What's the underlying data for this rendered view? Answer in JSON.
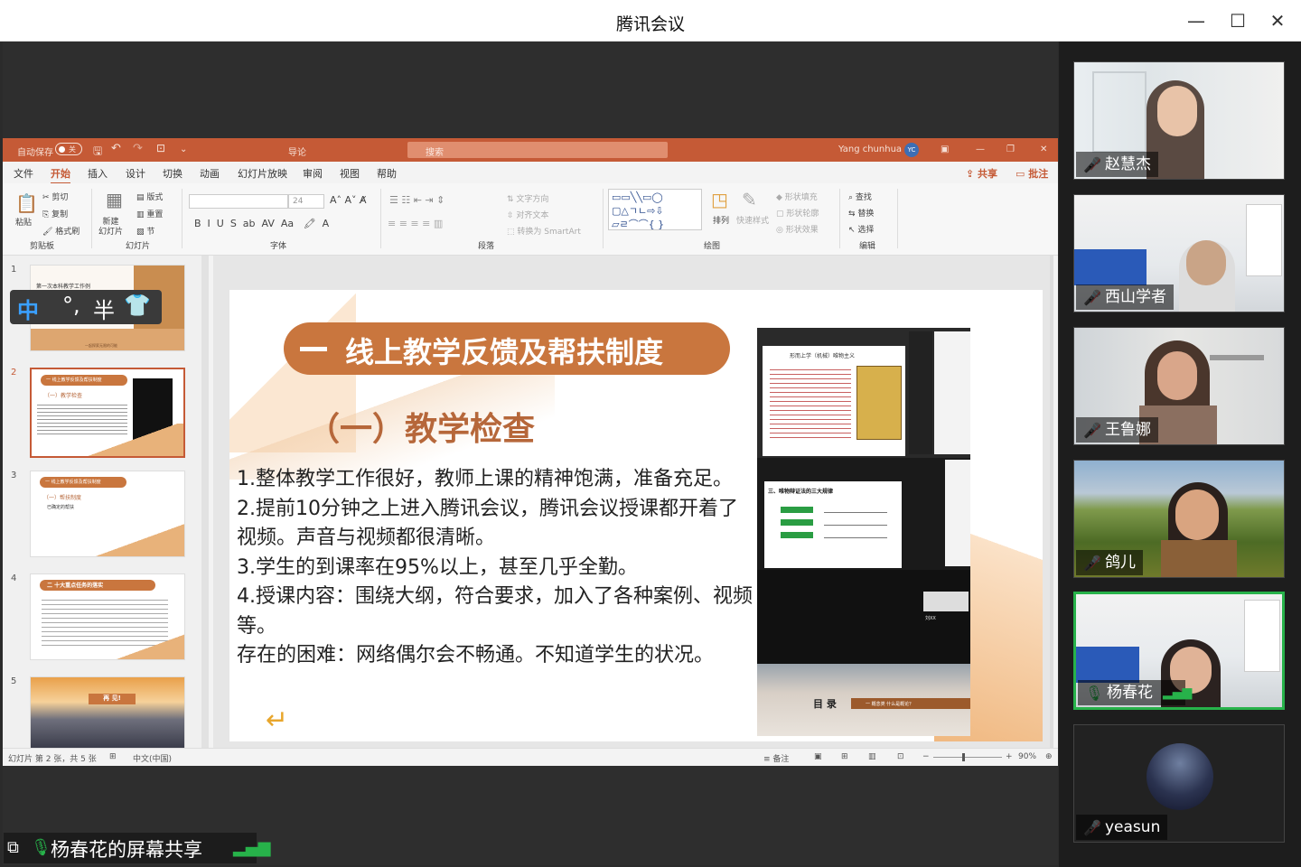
{
  "window": {
    "title": "腾讯会议"
  },
  "ppt": {
    "autosave": "自动保存",
    "autosave_state": "关",
    "doc_name": "导论",
    "search_placeholder": "搜索",
    "user": "Yang chunhua",
    "user_initials": "YC",
    "tabs": [
      "文件",
      "开始",
      "插入",
      "设计",
      "切换",
      "动画",
      "幻灯片放映",
      "审阅",
      "视图",
      "帮助"
    ],
    "share_label": "共享",
    "comment_label": "批注",
    "ribbon": {
      "clipboard": {
        "paste": "粘贴",
        "cut": "剪切",
        "copy": "复制",
        "format_painter": "格式刷",
        "group": "剪贴板"
      },
      "slides": {
        "new_slide": "新建\n幻灯片",
        "layout": "版式",
        "reset": "重置",
        "section": "节",
        "group": "幻灯片"
      },
      "font": {
        "size": "24",
        "group": "字体"
      },
      "paragraph": {
        "text_direction": "文字方向",
        "align_text": "对齐文本",
        "smartart": "转换为 SmartArt",
        "group": "段落"
      },
      "drawing": {
        "arrange": "排列",
        "quick_styles": "快速样式",
        "shape_fill": "形状填充",
        "shape_outline": "形状轮廓",
        "shape_effects": "形状效果",
        "group": "绘图"
      },
      "editing": {
        "find": "查找",
        "replace": "替换",
        "select": "选择",
        "group": "编辑"
      }
    },
    "ime": {
      "mode": "中",
      "punct": "°,",
      "width": "半"
    },
    "thumbnails": [
      {
        "num": "1",
        "title": "第一次本科教学工作例",
        "footer": "一起探索无限的可能"
      },
      {
        "num": "2",
        "banner": "一 线上教学反馈及帮扶制度",
        "sub": "（一）教学检查"
      },
      {
        "num": "3",
        "banner": "一 线上教学反馈及帮扶制度",
        "sub": "（一）帮扶制度",
        "line": "已确定的帮扶"
      },
      {
        "num": "4",
        "banner": "二 十大重点任务的落实"
      },
      {
        "num": "5",
        "banner": "再 见!"
      }
    ],
    "slide": {
      "banner": "线上教学反馈及帮扶制度",
      "subtitle": "（一）教学检查",
      "lines": [
        "1.整体教学工作很好，教师上课的精神饱满，准备充足。",
        "2.提前10分钟之上进入腾讯会议，腾讯会议授课都开着了视频。声音与视频都很清晰。",
        "3.学生的到课率在95%以上，甚至几乎全勤。",
        "4.授课内容：围绕大纲，符合要求，加入了各种案例、视频等。",
        "存在的困难：网络偶尔会不畅通。不知道学生的状况。"
      ],
      "embedded": {
        "title1": "形而上学（机械）唯物主义",
        "title2": "三、唯物辩证法的三大规律",
        "footer": "目 录",
        "footer_sub": "一 概念类    什么是概论？",
        "caption": "刘XX"
      }
    },
    "status": {
      "slide_info": "幻灯片 第 2 张，共 5 张",
      "language": "中文(中国)",
      "notes": "备注",
      "zoom": "90%"
    }
  },
  "share_bar": {
    "label": "杨春花的屏幕共享"
  },
  "participants": [
    {
      "name": "赵慧杰",
      "muted": true
    },
    {
      "name": "西山学者",
      "muted": true
    },
    {
      "name": "王鲁娜",
      "muted": true
    },
    {
      "name": "鸽儿",
      "muted": true
    },
    {
      "name": "杨春花",
      "muted": false,
      "speaking": true
    },
    {
      "name": "yeasun",
      "muted": true
    }
  ],
  "colors": {
    "accent": "#c55a36",
    "banner": "#c9763e",
    "active_speaker": "#27b24a",
    "muted": "#e14b4b"
  }
}
